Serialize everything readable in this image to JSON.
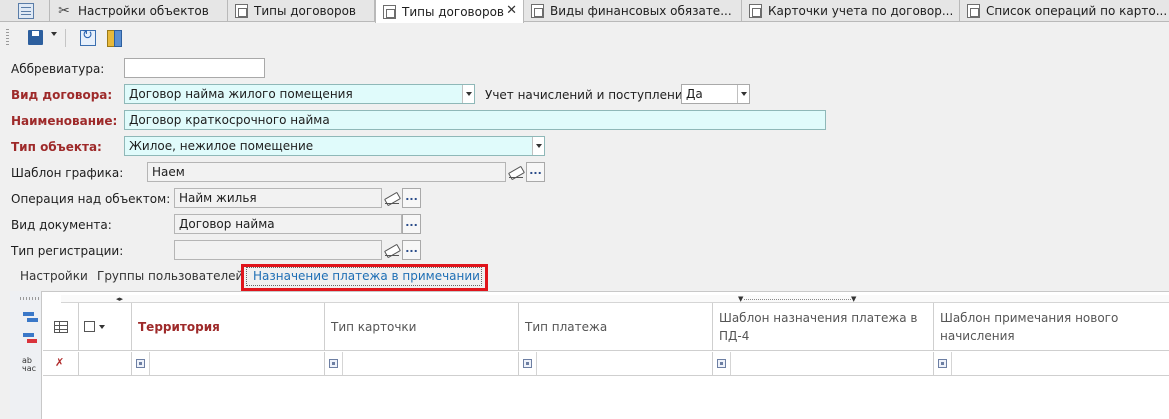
{
  "tabs": [
    {
      "label": "",
      "icon": "grid-icon"
    },
    {
      "label": "Настройки объектов",
      "icon": "tools-icon"
    },
    {
      "label": "Типы договоров",
      "icon": "form-icon"
    },
    {
      "label": "Типы договоров",
      "icon": "form-icon",
      "active": true,
      "close": "✕"
    },
    {
      "label": "Виды финансовых обязате...",
      "icon": "form-icon"
    },
    {
      "label": "Карточки учета по договор...",
      "icon": "form-icon"
    },
    {
      "label": "Список операций по карто...",
      "icon": "form-icon"
    }
  ],
  "form": {
    "abbr_label": "Аббревиатура:",
    "abbr_value": "",
    "contract_kind_label": "Вид договора:",
    "contract_kind_value": "Договор найма жилого помещения",
    "accrual_label": "Учет начислений и поступлений:",
    "accrual_value": "Да",
    "name_label": "Наименование:",
    "name_value": "Договор краткосрочного найма",
    "object_type_label": "Тип объекта:",
    "object_type_value": "Жилое, нежилое помещение",
    "schedule_label": "Шаблон графика:",
    "schedule_value": "Наем",
    "operation_label": "Операция над объектом:",
    "operation_value": "Найм жилья",
    "doc_kind_label": "Вид документа:",
    "doc_kind_value": "Договор найма",
    "reg_type_label": "Тип регистрации:",
    "reg_type_value": "",
    "ellipsis": "..."
  },
  "page_tabs": [
    {
      "label": "Настройки"
    },
    {
      "label": "Группы пользователей"
    },
    {
      "label": "Назначение платежа в примечании",
      "active": true
    }
  ],
  "grid": {
    "columns": [
      "Территория",
      "Тип карточки",
      "Тип платежа",
      "Шаблон назначения платежа в ПД-4",
      "Шаблон примечания нового начисления"
    ],
    "side_text": [
      "ab",
      "час"
    ]
  },
  "colors": {
    "required_label": "#9e2a2a",
    "required_field_bg": "#e0fbfb",
    "highlight": "#e0141b",
    "active_tab_text": "#1f6fb5"
  }
}
